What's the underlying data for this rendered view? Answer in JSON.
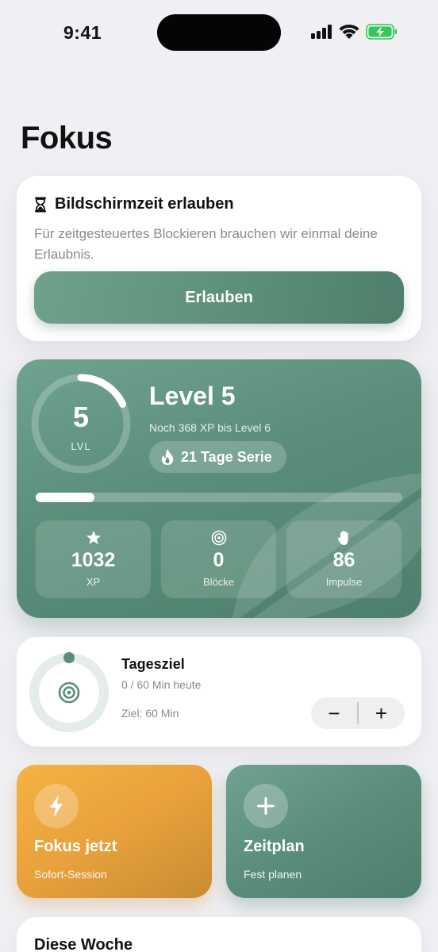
{
  "status_bar": {
    "time": "9:41"
  },
  "page": {
    "title": "Fokus"
  },
  "permission": {
    "icon": "hourglass-icon",
    "title": "Bildschirmzeit erlauben",
    "description": "Für zeitgesteuertes Blockieren brauchen wir einmal deine Erlaubnis.",
    "button_label": "Erlauben"
  },
  "level": {
    "number": "5",
    "lvl_label": "LVL",
    "ring_progress": 0.18,
    "title": "Level 5",
    "subtitle": "Noch 368 XP bis Level 6",
    "streak_label": "21 Tage Serie",
    "xp_progress": 0.16,
    "stats": [
      {
        "icon": "star-icon",
        "value": "1032",
        "label": "XP"
      },
      {
        "icon": "target-icon",
        "value": "0",
        "label": "Blöcke"
      },
      {
        "icon": "hand-icon",
        "value": "86",
        "label": "Impulse"
      }
    ]
  },
  "daily_goal": {
    "title": "Tagesziel",
    "progress_text": "0 / 60 Min heute",
    "target_text": "Ziel: 60 Min",
    "progress": 0,
    "minus_label": "−",
    "plus_label": "+"
  },
  "actions": {
    "focus": {
      "icon": "bolt-icon",
      "title": "Fokus jetzt",
      "subtitle": "Sofort-Session"
    },
    "schedule": {
      "icon": "plus-icon",
      "title": "Zeitplan",
      "subtitle": "Fest planen"
    }
  },
  "week": {
    "title": "Diese Woche"
  },
  "colors": {
    "accent_green": "#5a8e7a",
    "accent_orange": "#e8a13c",
    "background": "#f0f0f4",
    "battery_green": "#34c759"
  }
}
